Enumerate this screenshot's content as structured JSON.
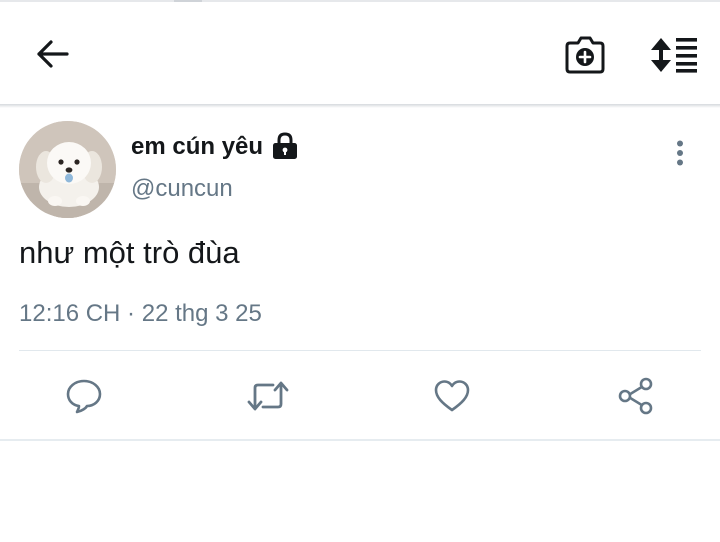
{
  "toolbar": {
    "back": "arrow-left-icon",
    "camera": "camera-plus-icon",
    "sort": "sort-lines-icon"
  },
  "tweet": {
    "display_name": "em cún yêu",
    "protected_icon": "lock-icon",
    "handle": "@cuncun",
    "text": "như một trò đùa",
    "timestamp": "12:16 CH · 22 thg 3 25",
    "more": "more-vertical-icon"
  },
  "actions": {
    "reply": "reply-icon",
    "retweet": "retweet-icon",
    "like": "heart-icon",
    "share": "share-icon"
  },
  "colors": {
    "text": "#14171a",
    "secondary": "#657786",
    "action": "#657786",
    "divider": "#e1e8ed"
  }
}
